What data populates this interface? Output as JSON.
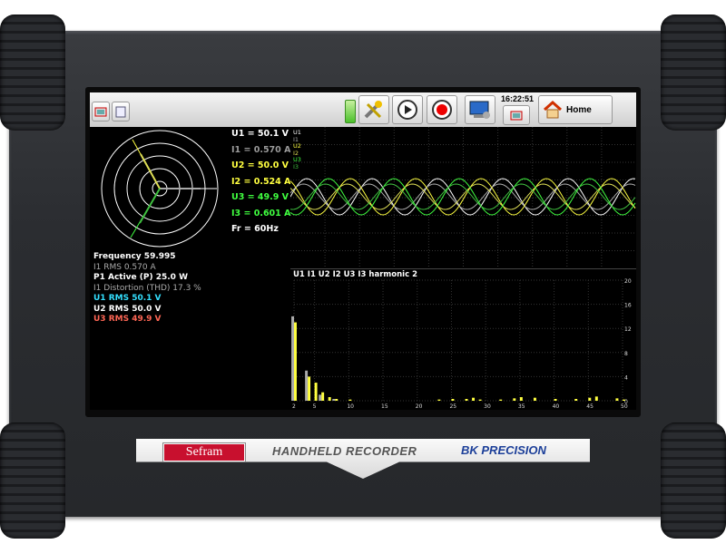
{
  "toolbar": {
    "time": "16:22:51",
    "home_label": "Home"
  },
  "vector_diagram": {
    "readings": [
      {
        "label": "U1",
        "value": "50.1 V",
        "color": "#ffffff"
      },
      {
        "label": "I1",
        "value": "0.570 A",
        "color": "#9a9a9a"
      },
      {
        "label": "U2",
        "value": "50.0 V",
        "color": "#ffff40"
      },
      {
        "label": "I2",
        "value": "0.524 A",
        "color": "#ffff40"
      },
      {
        "label": "U3",
        "value": "49.9 V",
        "color": "#40ff40"
      },
      {
        "label": "I3",
        "value": "0.601 A",
        "color": "#40ff40"
      }
    ],
    "frequency_ref": "Fr = 60Hz"
  },
  "measurements": [
    {
      "text": "Frequency  59.995",
      "color": "#ffffff",
      "bold": true
    },
    {
      "text": "I1 RMS  0.570 A",
      "color": "#aaaaaa",
      "bold": false
    },
    {
      "text": "P1 Active (P)  25.0 W",
      "color": "#ffffff",
      "bold": true
    },
    {
      "text": "I1 Distortion (THD)  17.3 %",
      "color": "#aaaaaa",
      "bold": false
    },
    {
      "text": "U1 RMS  50.1 V",
      "color": "#33e0ff",
      "bold": true
    },
    {
      "text": "U2 RMS  50.0 V",
      "color": "#ffffff",
      "bold": true
    },
    {
      "text": "U3 RMS  49.9 V",
      "color": "#ff6655",
      "bold": true
    }
  ],
  "waveform": {
    "channel_labels": [
      {
        "name": "U1",
        "color": "#ffffff"
      },
      {
        "name": "I1",
        "color": "#aaaaaa"
      },
      {
        "name": "U2",
        "color": "#ffff40"
      },
      {
        "name": "I2",
        "color": "#dddd55"
      },
      {
        "name": "U3",
        "color": "#40ff40"
      },
      {
        "name": "I3",
        "color": "#40c040"
      }
    ]
  },
  "harmonic": {
    "title": "U1 I1 U2 I2 U3 I3 harmonic 2",
    "x_ticks": [
      "2",
      "5",
      "10",
      "15",
      "20",
      "25",
      "30",
      "35",
      "40",
      "45",
      "50"
    ],
    "y_ticks": [
      "0",
      "4",
      "8",
      "12",
      "16",
      "20"
    ]
  },
  "chart_data": {
    "type": "bar",
    "title": "U1 I1 U2 I2 U3 I3 harmonic 2",
    "xlabel": "",
    "ylabel": "",
    "ylim": [
      0,
      20
    ],
    "xlim": [
      2,
      50
    ],
    "grid": true,
    "categories": [
      2,
      3,
      4,
      5,
      6,
      7,
      8,
      9,
      10,
      11,
      12,
      13,
      14,
      15,
      16,
      17,
      18,
      19,
      20,
      21,
      22,
      23,
      24,
      25,
      26,
      27,
      28,
      29,
      30,
      31,
      32,
      33,
      34,
      35,
      36,
      37,
      38,
      39,
      40,
      41,
      42,
      43,
      44,
      45,
      46,
      47,
      48,
      49,
      50
    ],
    "series": [
      {
        "color": "#aaaaaa",
        "values": [
          14,
          0,
          5,
          0,
          1,
          0,
          0.3,
          0,
          0,
          0,
          0,
          0,
          0,
          0,
          0,
          0,
          0,
          0,
          0,
          0,
          0,
          0,
          0,
          0,
          0,
          0,
          0,
          0,
          0,
          0,
          0,
          0,
          0,
          0,
          0,
          0,
          0,
          0,
          0,
          0,
          0,
          0,
          0,
          0,
          0,
          0,
          0,
          0,
          0
        ]
      },
      {
        "color": "#ffff40",
        "values": [
          13,
          0,
          4,
          3,
          1.4,
          0.6,
          0.3,
          0,
          0.2,
          0,
          0,
          0,
          0,
          0,
          0,
          0,
          0,
          0,
          0,
          0,
          0,
          0.2,
          0,
          0.3,
          0,
          0.3,
          0.5,
          0.2,
          0,
          0,
          0.2,
          0,
          0.4,
          0.6,
          0,
          0.5,
          0,
          0,
          0.3,
          0,
          0,
          0.3,
          0,
          0.5,
          0.7,
          0,
          0,
          0.4,
          0.2
        ]
      }
    ]
  },
  "branding": {
    "sefram": "Sefram",
    "product": "HANDHELD RECORDER",
    "bk": "BK PRECISION"
  }
}
